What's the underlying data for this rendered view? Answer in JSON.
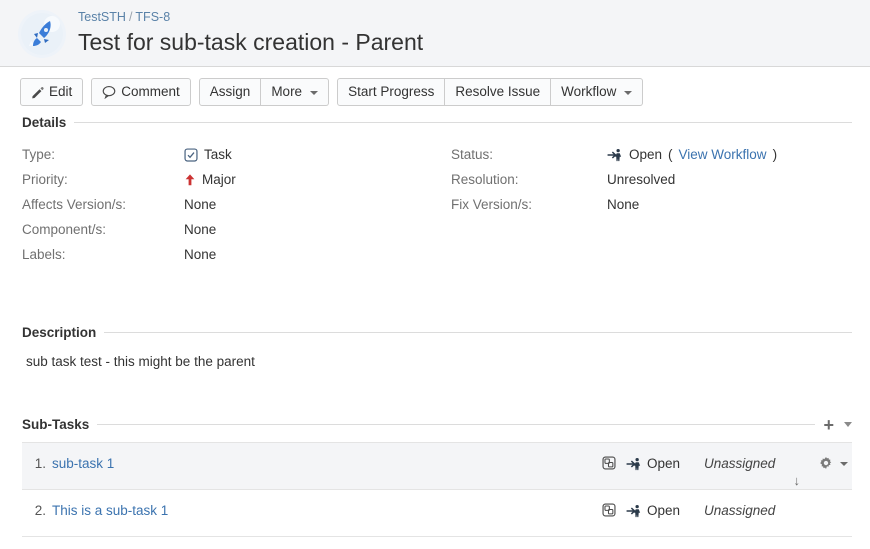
{
  "header": {
    "avatar_icon": "rocket-avatar",
    "breadcrumb": {
      "project": "TestSTH",
      "separator": "/",
      "issue_key": "TFS-8"
    },
    "title": "Test for sub-task creation - Parent"
  },
  "toolbar": {
    "edit_label": "Edit",
    "comment_label": "Comment",
    "assign_label": "Assign",
    "more_label": "More",
    "start_progress_label": "Start Progress",
    "resolve_issue_label": "Resolve Issue",
    "workflow_label": "Workflow"
  },
  "details": {
    "heading": "Details",
    "left": [
      {
        "label": "Type:",
        "value": "Task",
        "icon": "task-type-icon"
      },
      {
        "label": "Priority:",
        "value": "Major",
        "icon": "priority-major-icon"
      },
      {
        "label": "Affects Version/s:",
        "value": "None",
        "icon": ""
      },
      {
        "label": "Component/s:",
        "value": "None",
        "icon": ""
      },
      {
        "label": "Labels:",
        "value": "None",
        "icon": ""
      }
    ],
    "right": [
      {
        "label": "Status:",
        "value": "Open",
        "icon": "status-open-icon",
        "link": "View Workflow"
      },
      {
        "label": "Resolution:",
        "value": "Unresolved",
        "icon": ""
      },
      {
        "label": "Fix Version/s:",
        "value": "None",
        "icon": ""
      }
    ]
  },
  "description": {
    "heading": "Description",
    "body": "sub task test - this might be the parent"
  },
  "subtasks": {
    "heading": "Sub-Tasks",
    "add_icon": "plus-icon",
    "collapse_icon": "chevron-down-icon",
    "rows": [
      {
        "number": "1.",
        "title": "sub-task 1",
        "type_icon": "subtask-type-icon",
        "status_icon": "status-open-icon",
        "status": "Open",
        "assignee": "Unassigned",
        "has_ops": true,
        "move_down_icon": "arrow-down-icon",
        "hovered": true
      },
      {
        "number": "2.",
        "title": "This is a sub-task 1",
        "type_icon": "subtask-type-icon",
        "status_icon": "status-open-icon",
        "status": "Open",
        "assignee": "Unassigned",
        "has_ops": false,
        "move_down_icon": "",
        "hovered": false
      }
    ]
  },
  "colors": {
    "link": "#3b73af",
    "header_bg": "#f4f5f7",
    "priority_major": "#cc3333",
    "row_hover": "#f4f5f7",
    "border": "#e4e4e4"
  }
}
